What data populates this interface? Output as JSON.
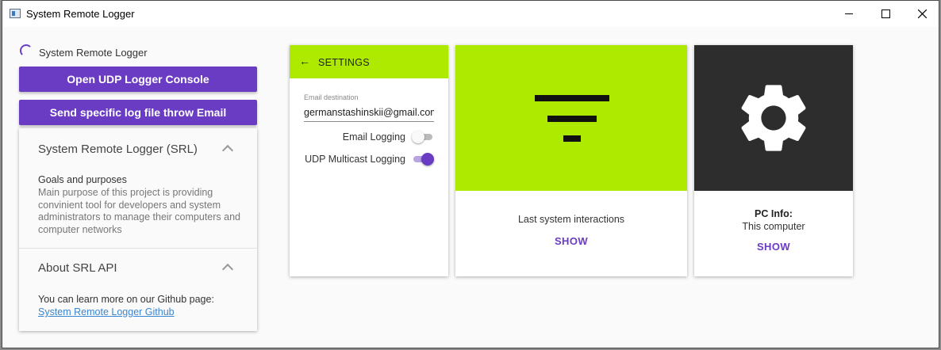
{
  "window": {
    "title": "System Remote Logger",
    "controls": {
      "minimize": "minimize",
      "maximize": "maximize",
      "close": "close"
    }
  },
  "header": {
    "app_name": "System Remote Logger"
  },
  "buttons": {
    "udp_console": "Open UDP Logger Console",
    "send_log_email": "Send specific log file throw Email"
  },
  "accordion": {
    "section1": {
      "title": "System Remote Logger (SRL)",
      "subtitle": "Goals and purposes",
      "body": "Main purpose of this project is providing convinient tool for developers and system administrators to manage their computers and computer networks"
    },
    "section2": {
      "title": "About SRL API",
      "text": "You can learn more on our Github page:",
      "link": "System Remote Logger Github"
    }
  },
  "settings": {
    "title": "SETTINGS",
    "email_label": "Email destination",
    "email_value": "germanstashinskii@gmail.com",
    "toggles": [
      {
        "label": "Email Logging",
        "on": false
      },
      {
        "label": "UDP Multicast Logging",
        "on": true
      }
    ]
  },
  "cards": {
    "interactions": {
      "text": "Last system interactions",
      "action": "SHOW",
      "icon": "filter-icon"
    },
    "pc_info": {
      "title": "PC Info:",
      "text": "This computer",
      "action": "SHOW",
      "icon": "gear-icon"
    }
  },
  "colors": {
    "primary": "#6a3cc4",
    "lime": "#aeea00",
    "dark_media": "#2d2d2d",
    "link": "#3a86d0"
  }
}
